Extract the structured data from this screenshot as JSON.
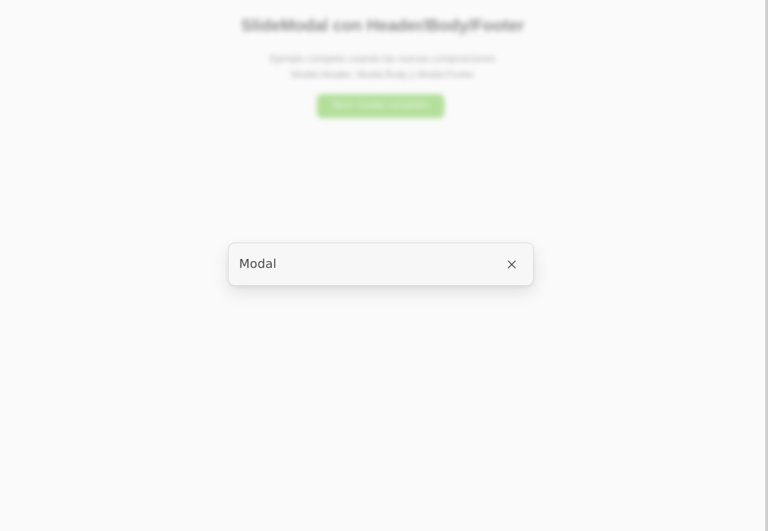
{
  "background_page": {
    "title": "SlideModal con Header/Body/Footer",
    "subtitle_line1": "Ejemplo completo usando las nuevas composiciones",
    "subtitle_line2": "Modal.Header, Modal.Body y Modal.Footer",
    "action_button_label": "Abrir modal completo",
    "action_button_color": "#7bc94e"
  },
  "modal": {
    "title": "Modal",
    "close_icon": "close-icon"
  }
}
